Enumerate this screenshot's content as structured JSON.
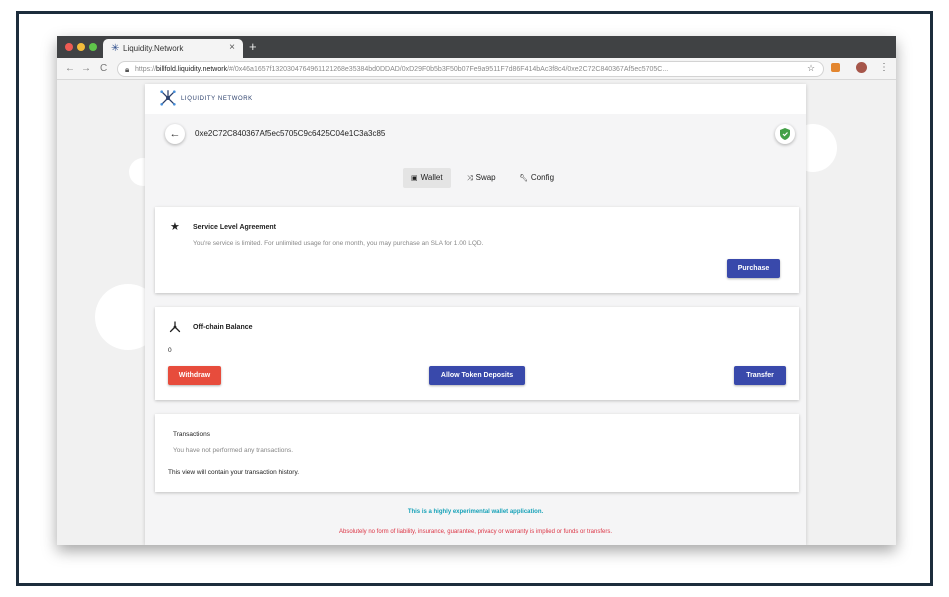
{
  "browser": {
    "tab_title": "Liquidity.Network",
    "tab_close": "×",
    "new_tab": "+",
    "url_scheme": "https://",
    "url_host": "billfold.liquidity.network",
    "url_path": "/#/0x46a1657f1320304764961121268e35384bd0DDAD/0xD29F0b5b3F50b07Fe9a9511F7d86F414bAc3f8c4/0xe2C72C840367Af5ec5705C...",
    "icons": {
      "back": "arrow-left-icon",
      "forward": "arrow-right-icon",
      "reload": "reload-icon",
      "lock": "lock-icon",
      "star": "star-icon",
      "menu": "kebab-menu-icon"
    }
  },
  "app": {
    "logo_text": "LIQUIDITY NETWORK",
    "wallet_address": "0xe2C72C840367Af5ec5705C9c6425C04e1C3a3c85",
    "nav": {
      "wallet": "Wallet",
      "swap": "Swap",
      "config": "Config"
    },
    "sla": {
      "title": "Service Level Agreement",
      "text": "You're service is limited. For unlimited usage for one month, you may purchase an SLA for 1.00 LQD.",
      "purchase_label": "Purchase"
    },
    "offchain": {
      "title": "Off-chain Balance",
      "balance": "0",
      "withdraw_label": "Withdraw",
      "allow_label": "Allow Token Deposits",
      "transfer_label": "Transfer"
    },
    "transactions": {
      "title": "Transactions",
      "empty_text": "You have not performed any transactions.",
      "history_text": "This view will contain your transaction history."
    },
    "footer": {
      "experimental": "This is a highly experimental wallet application.",
      "disclaimer": "Absolutely no form of liability, insurance, guarantee, privacy or warranty is implied or funds or transfers."
    }
  },
  "colors": {
    "primary": "#3949ab",
    "danger": "#e74c3c",
    "info": "#17a2b8",
    "frame": "#1c2d3c",
    "shield": "#43a047"
  }
}
